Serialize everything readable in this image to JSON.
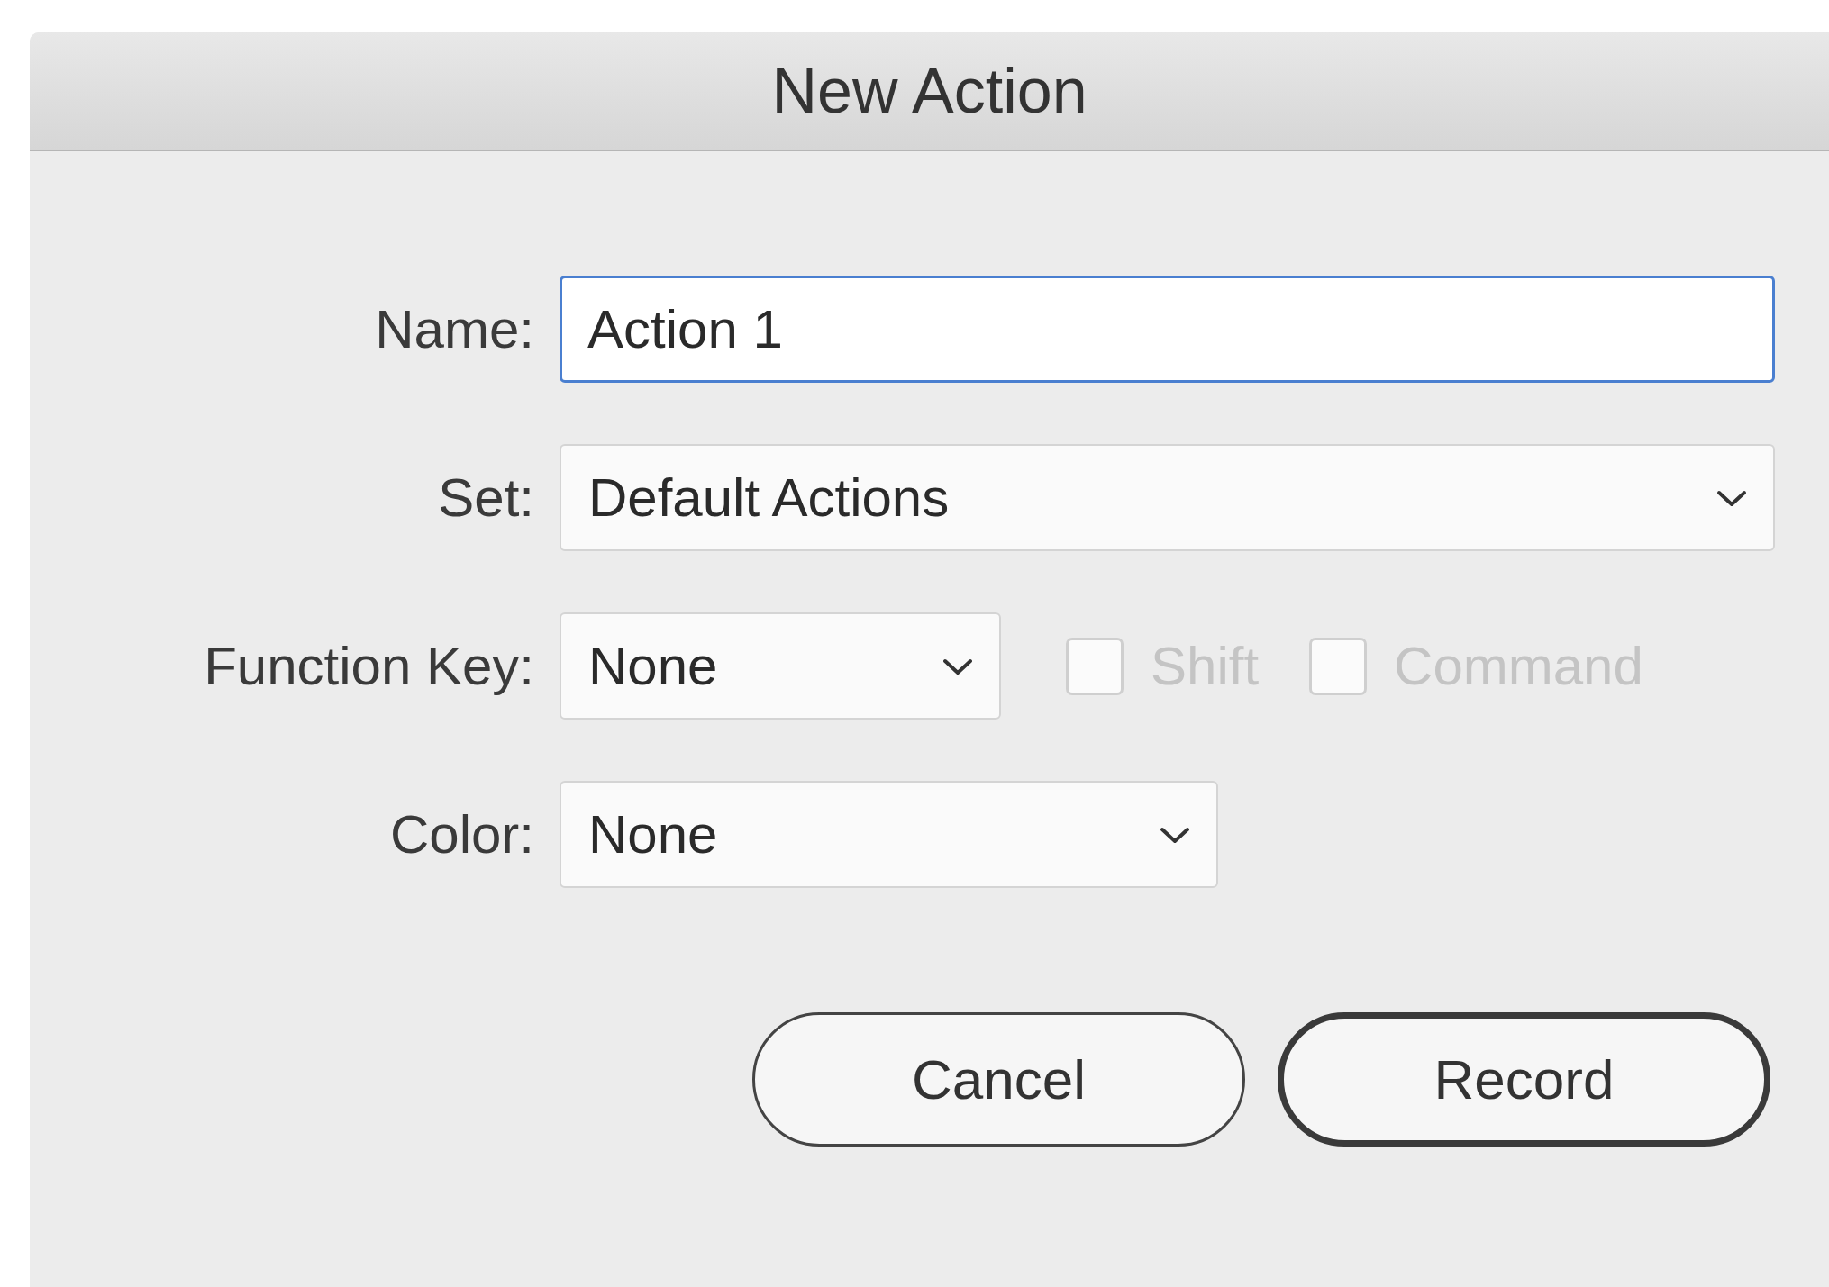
{
  "window": {
    "title": "New Action"
  },
  "fields": [
    {
      "kind": "text",
      "label": "Name:",
      "value": "Action 1",
      "focused": true
    },
    {
      "kind": "select",
      "label": "Set:",
      "value": "Default Actions"
    },
    {
      "kind": "select",
      "label": "Function Key:",
      "value": "None",
      "checkboxes": [
        {
          "label": "Shift",
          "checked": false,
          "disabled": true
        },
        {
          "label": "Command",
          "checked": false,
          "disabled": true
        }
      ]
    },
    {
      "kind": "select",
      "label": "Color:",
      "value": "None"
    }
  ],
  "buttons": [
    {
      "label": "Cancel",
      "default": false
    },
    {
      "label": "Record",
      "default": true
    }
  ]
}
